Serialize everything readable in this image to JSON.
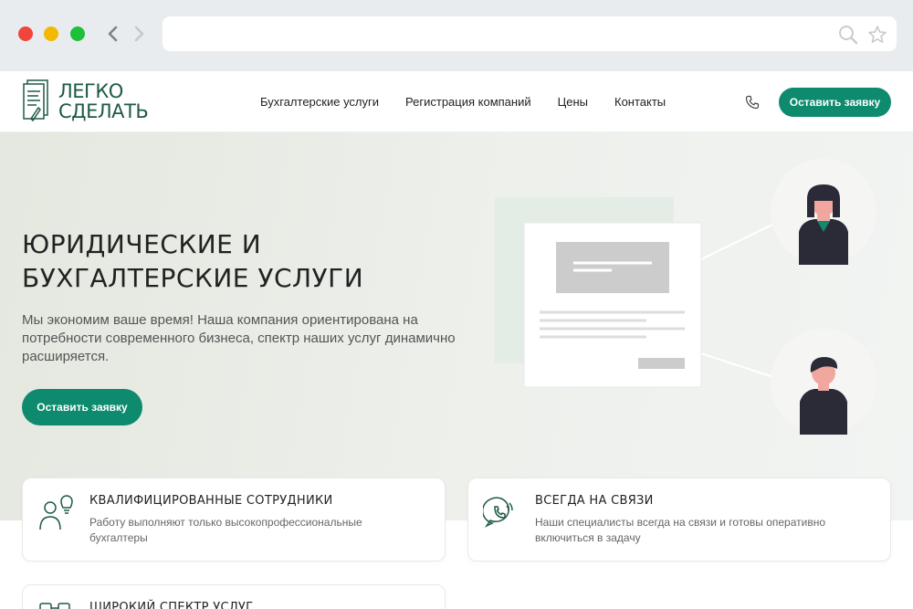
{
  "header": {
    "logo": {
      "line1": "ЛЕГКО",
      "line2": "СДЕЛАТЬ"
    },
    "nav": [
      "Бухгалтерские услуги",
      "Регистрация компаний",
      "Цены",
      "Контакты"
    ],
    "cta_label": "Оставить заявку"
  },
  "hero": {
    "title_line1": "ЮРИДИЧЕСКИЕ И",
    "title_line2": "БУХГАЛТЕРСКИЕ УСЛУГИ",
    "subtitle": "Мы экономим ваше время! Наша компания ориентирована на потребности современного бизнеса, спектр наших услуг динамично расширяется.",
    "cta_label": "Оставить заявку"
  },
  "features": [
    {
      "title": "КВАЛИФИЦИРОВАННЫЕ СОТРУДНИКИ",
      "text": "Работу выполняют только высокопрофессиональные бухгалтеры",
      "icon": "people-idea-icon"
    },
    {
      "title": "ВСЕГДА НА СВЯЗИ",
      "text": "Наши специалисты всегда на связи и готовы оперативно включиться в задачу",
      "icon": "chat-phone-icon"
    },
    {
      "title": "ШИРОКИЙ СПЕКТР УСЛУГ",
      "text": "",
      "icon": "services-icon"
    }
  ],
  "colors": {
    "accent": "#0e8a6e",
    "brand": "#1e5a46"
  }
}
